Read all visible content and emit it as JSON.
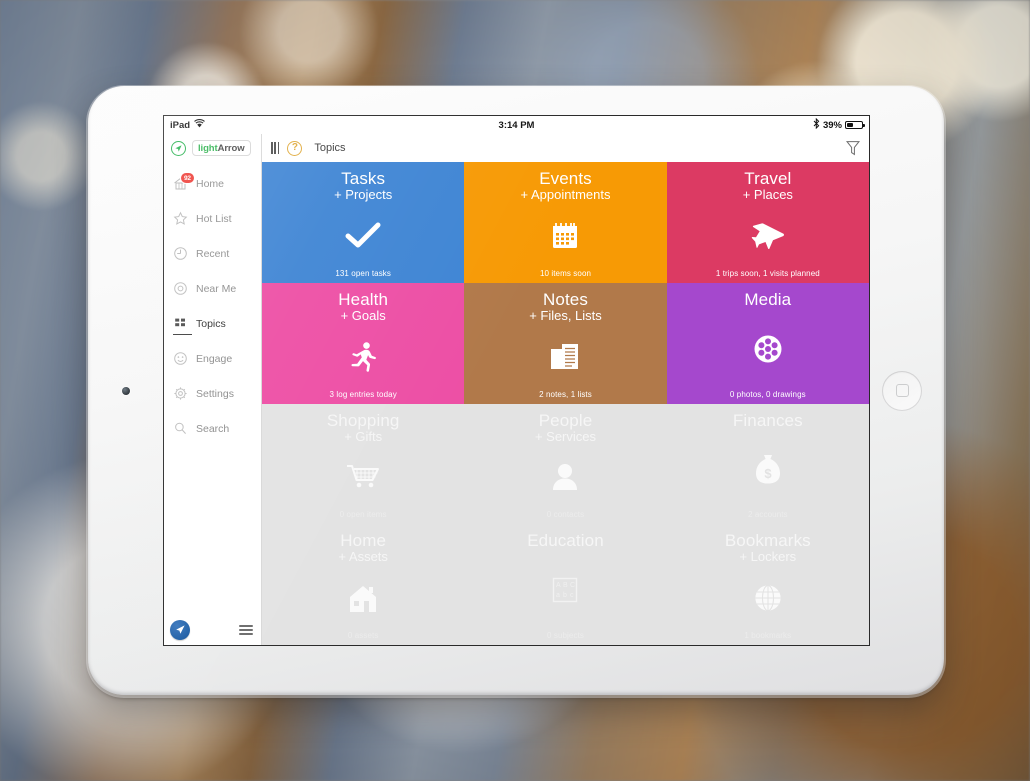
{
  "device": {
    "name": "ipad-tablet",
    "home_button": "home-button"
  },
  "statusbar": {
    "carrier": "iPad",
    "wifi_icon": "wifi-icon",
    "time": "3:14 PM",
    "bluetooth_icon": "bluetooth-icon",
    "battery_percent": "39%",
    "battery_icon": "battery-icon"
  },
  "brand": {
    "mark_icon": "lightarrow-circle-icon",
    "name_light": "light",
    "name_arrow": "Arrow",
    "full": "lightArrow"
  },
  "sidebar": {
    "items": [
      {
        "label": "Home",
        "icon": "home-icon",
        "badge": "92",
        "active": false
      },
      {
        "label": "Hot List",
        "icon": "star-icon",
        "badge": "",
        "active": false
      },
      {
        "label": "Recent",
        "icon": "clock-icon",
        "badge": "",
        "active": false
      },
      {
        "label": "Near Me",
        "icon": "target-icon",
        "badge": "",
        "active": false
      },
      {
        "label": "Topics",
        "icon": "grid-icon",
        "badge": "",
        "active": true
      },
      {
        "label": "Engage",
        "icon": "smiley-icon",
        "badge": "",
        "active": false
      },
      {
        "label": "Settings",
        "icon": "gear-icon",
        "badge": "",
        "active": false
      },
      {
        "label": "Search",
        "icon": "search-icon",
        "badge": "",
        "active": false
      }
    ],
    "footer": {
      "compass_icon": "compass-icon",
      "menu_icon": "hamburger-menu-icon"
    }
  },
  "toolbar": {
    "columns_icon": "columns-icon",
    "help_icon": "help-question-icon",
    "help_label": "?",
    "title": "Topics",
    "filter_icon": "filter-funnel-icon"
  },
  "tiles": [
    {
      "title": "Tasks",
      "sub": "+ Projects",
      "footer": "131 open tasks",
      "icon": "checkmark-icon",
      "color": "#3f85d4",
      "dim": false
    },
    {
      "title": "Events",
      "sub": "+ Appointments",
      "footer": "10 items soon",
      "icon": "calendar-icon",
      "color": "#f79a05",
      "dim": false
    },
    {
      "title": "Travel",
      "sub": "+ Places",
      "footer": "1 trips soon, 1 visits planned",
      "icon": "airplane-icon",
      "color": "#dc3a63",
      "dim": false
    },
    {
      "title": "Health",
      "sub": "+ Goals",
      "footer": "3 log entries today",
      "icon": "runner-icon",
      "color": "#ed4fa5",
      "dim": false
    },
    {
      "title": "Notes",
      "sub": "+ Files, Lists",
      "footer": "2 notes, 1 lists",
      "icon": "documents-icon",
      "color": "#b1794a",
      "dim": false
    },
    {
      "title": "Media",
      "sub": "",
      "footer": "0 photos, 0 drawings",
      "icon": "film-reel-icon",
      "color": "#a548cd",
      "dim": false
    },
    {
      "title": "Shopping",
      "sub": "+ Gifts",
      "footer": "0 open items",
      "icon": "shopping-cart-icon",
      "color": "#e3e3e3",
      "dim": true
    },
    {
      "title": "People",
      "sub": "+ Services",
      "footer": "0 contacts",
      "icon": "person-icon",
      "color": "#e3e3e3",
      "dim": true
    },
    {
      "title": "Finances",
      "sub": "",
      "footer": "2 accounts",
      "icon": "money-bag-icon",
      "color": "#e3e3e3",
      "dim": true
    },
    {
      "title": "Home",
      "sub": "+ Assets",
      "footer": "0 assets",
      "icon": "house-icon",
      "color": "#e3e3e3",
      "dim": true
    },
    {
      "title": "Education",
      "sub": "",
      "footer": "0 subjects",
      "icon": "abc-block-icon",
      "color": "#e3e3e3",
      "dim": true
    },
    {
      "title": "Bookmarks",
      "sub": "+ Lockers",
      "footer": "1 bookmarks",
      "icon": "globe-icon",
      "color": "#e3e3e3",
      "dim": true
    }
  ],
  "colors": {
    "tasks": "#3f85d4",
    "events": "#f79a05",
    "travel": "#dc3a63",
    "health": "#ed4fa5",
    "notes": "#b1794a",
    "media": "#a548cd",
    "dimmed": "#e3e3e3",
    "badge": "#ee3b35",
    "brand_green": "#2fb350"
  }
}
